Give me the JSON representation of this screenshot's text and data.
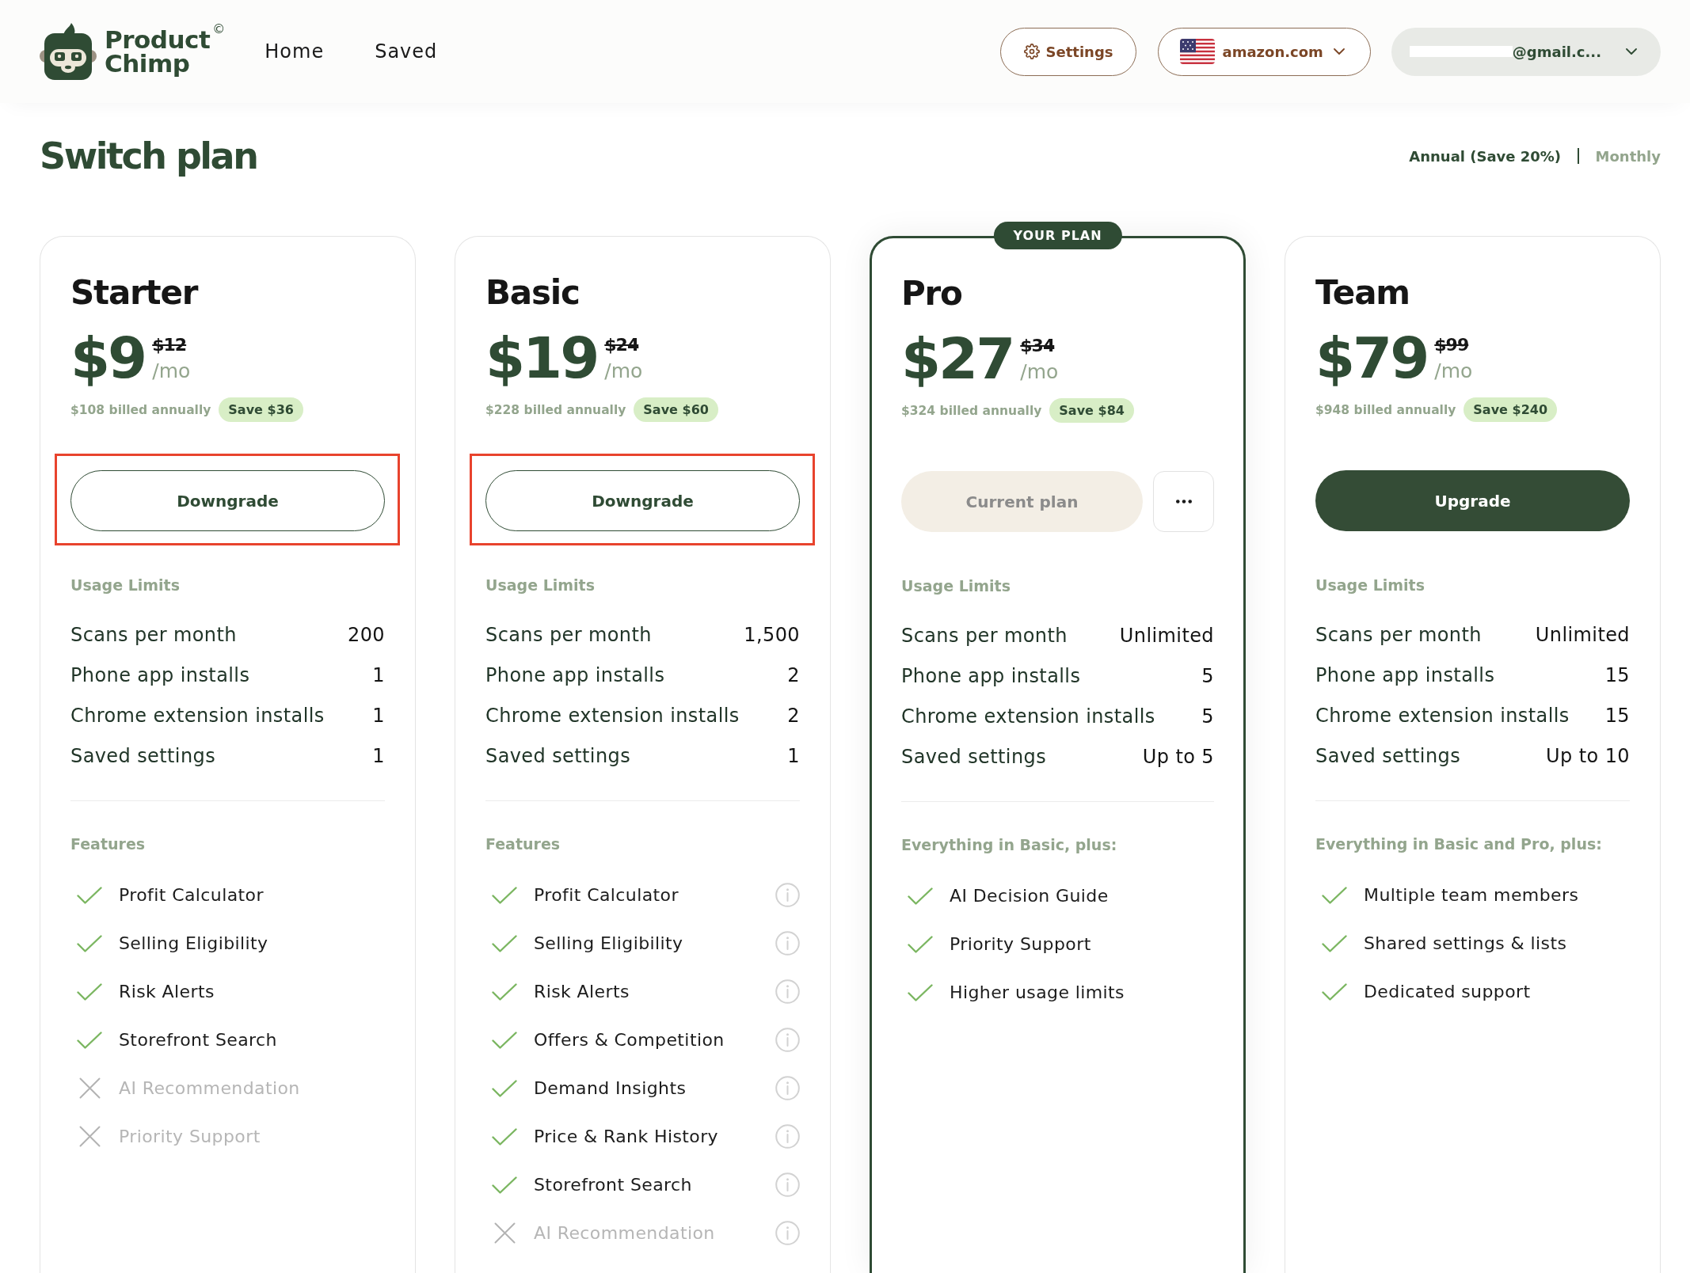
{
  "header": {
    "logo": {
      "lines": [
        "Product",
        "Chimp"
      ],
      "mark": "©"
    },
    "nav": [
      {
        "label": "Home",
        "selected": false
      },
      {
        "label": "Saved",
        "selected": false
      }
    ],
    "settings_button": {
      "label": "Settings"
    },
    "marketplace": {
      "label": "amazon.com"
    },
    "account": {
      "email": "@gmail.c...",
      "redacted": true
    }
  },
  "page_title": "Switch plan",
  "billing_toggle": [
    {
      "label": "Annual (Save 20%)",
      "selected": true
    },
    {
      "label": "Monthly",
      "selected": false
    }
  ],
  "plans": [
    {
      "name": "Starter",
      "current": false,
      "price": "$9",
      "old_price": "$12",
      "period": "/mo",
      "billing": "$108 billed annually",
      "savings": "Save $36",
      "action": {
        "kind": "outline",
        "label": "Downgrade"
      },
      "more_button": false,
      "highlighted": true,
      "usage_title": "Usage Limits",
      "limits": [
        {
          "label": "Scans per month",
          "value": "200"
        },
        {
          "label": "Phone app installs",
          "value": "1"
        },
        {
          "label": "Chrome extension installs",
          "value": "1"
        },
        {
          "label": "Saved settings",
          "value": "1"
        }
      ],
      "features_title": "Features",
      "features": [
        {
          "label": "Profit Calculator",
          "included": true,
          "info": false
        },
        {
          "label": "Selling Eligibility",
          "included": true,
          "info": false
        },
        {
          "label": "Risk Alerts",
          "included": true,
          "info": false
        },
        {
          "label": "Storefront Search",
          "included": true,
          "info": false
        },
        {
          "label": "AI Recommendation",
          "included": false,
          "info": false
        },
        {
          "label": "Priority Support",
          "included": false,
          "info": false
        }
      ]
    },
    {
      "name": "Basic",
      "current": false,
      "price": "$19",
      "old_price": "$24",
      "period": "/mo",
      "billing": "$228 billed annually",
      "savings": "Save $60",
      "action": {
        "kind": "outline",
        "label": "Downgrade"
      },
      "more_button": false,
      "highlighted": true,
      "usage_title": "Usage Limits",
      "limits": [
        {
          "label": "Scans per month",
          "value": "1,500"
        },
        {
          "label": "Phone app installs",
          "value": "2"
        },
        {
          "label": "Chrome extension installs",
          "value": "2"
        },
        {
          "label": "Saved settings",
          "value": "1"
        }
      ],
      "features_title": "Features",
      "features": [
        {
          "label": "Profit Calculator",
          "included": true,
          "info": true
        },
        {
          "label": "Selling Eligibility",
          "included": true,
          "info": true
        },
        {
          "label": "Risk Alerts",
          "included": true,
          "info": true
        },
        {
          "label": "Offers & Competition",
          "included": true,
          "info": true
        },
        {
          "label": "Demand Insights",
          "included": true,
          "info": true
        },
        {
          "label": "Price & Rank History",
          "included": true,
          "info": true
        },
        {
          "label": "Storefront Search",
          "included": true,
          "info": true
        },
        {
          "label": "AI Recommendation",
          "included": false,
          "info": true
        }
      ]
    },
    {
      "name": "Pro",
      "current": true,
      "badge": "YOUR PLAN",
      "price": "$27",
      "old_price": "$34",
      "period": "/mo",
      "billing": "$324 billed annually",
      "savings": "Save $84",
      "action": {
        "kind": "current",
        "label": "Current plan"
      },
      "more_button": true,
      "highlighted": false,
      "usage_title": "Usage Limits",
      "limits": [
        {
          "label": "Scans per month",
          "value": "Unlimited"
        },
        {
          "label": "Phone app installs",
          "value": "5"
        },
        {
          "label": "Chrome extension installs",
          "value": "5"
        },
        {
          "label": "Saved settings",
          "value": "Up to 5"
        }
      ],
      "features_title": "Everything in Basic, plus:",
      "features": [
        {
          "label": "AI Decision Guide",
          "included": true,
          "info": false
        },
        {
          "label": "Priority Support",
          "included": true,
          "info": false
        },
        {
          "label": "Higher usage limits",
          "included": true,
          "info": false
        }
      ]
    },
    {
      "name": "Team",
      "current": false,
      "price": "$79",
      "old_price": "$99",
      "period": "/mo",
      "billing": "$948 billed annually",
      "savings": "Save $240",
      "action": {
        "kind": "filled",
        "label": "Upgrade"
      },
      "more_button": false,
      "highlighted": false,
      "usage_title": "Usage Limits",
      "limits": [
        {
          "label": "Scans per month",
          "value": "Unlimited"
        },
        {
          "label": "Phone app installs",
          "value": "15"
        },
        {
          "label": "Chrome extension installs",
          "value": "15"
        },
        {
          "label": "Saved settings",
          "value": "Up to 10"
        }
      ],
      "features_title": "Everything in Basic and Pro, plus:",
      "features": [
        {
          "label": "Multiple team members",
          "included": true,
          "info": false
        },
        {
          "label": "Shared settings & lists",
          "included": true,
          "info": false
        },
        {
          "label": "Dedicated support",
          "included": true,
          "info": false
        }
      ]
    }
  ]
}
